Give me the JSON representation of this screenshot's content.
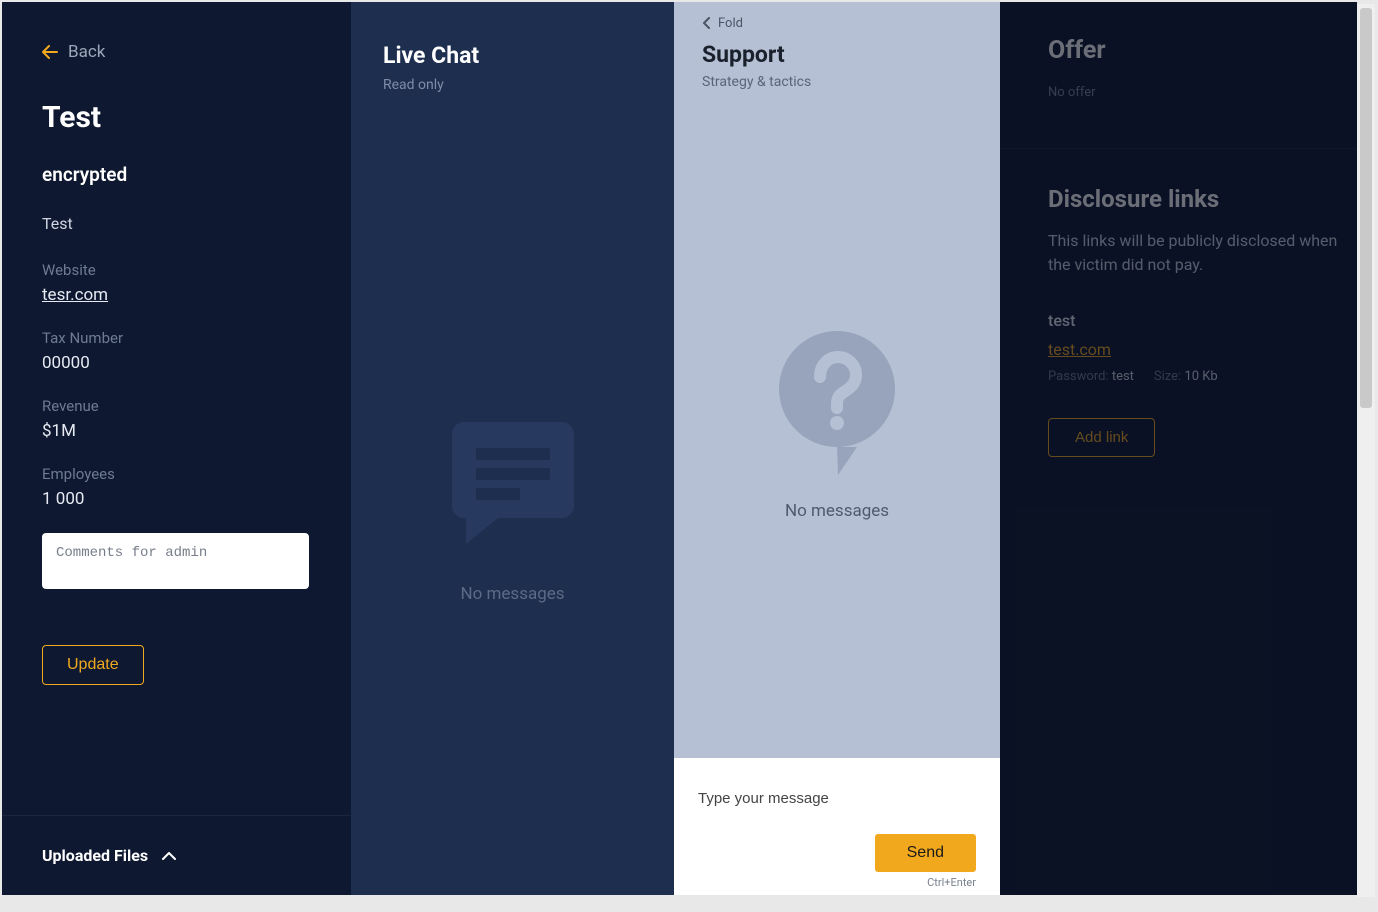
{
  "details": {
    "back_label": "Back",
    "title": "Test",
    "status": "encrypted",
    "description": "Test",
    "website_label": "Website",
    "website_value": "tesr.com",
    "tax_label": "Tax Number",
    "tax_value": "00000",
    "revenue_label": "Revenue",
    "revenue_value": "$1M",
    "employees_label": "Employees",
    "employees_value": "1 000",
    "comments_placeholder": "Comments for admin",
    "update_button": "Update",
    "uploaded_files_label": "Uploaded Files"
  },
  "live_chat": {
    "title": "Live Chat",
    "subtitle": "Read only",
    "empty_text": "No messages"
  },
  "support": {
    "fold_label": "Fold",
    "title": "Support",
    "subtitle": "Strategy & tactics",
    "empty_text": "No messages",
    "compose_placeholder": "Type your message",
    "send_button": "Send",
    "send_hint": "Ctrl+Enter"
  },
  "right": {
    "offer_title": "Offer",
    "no_offer": "No offer",
    "disclosure_title": "Disclosure links",
    "disclosure_desc": "This links will be publicly disclosed when the victim did not pay.",
    "link_name": "test",
    "link_url": "test.com",
    "password_label": "Password:",
    "password_value": "test",
    "size_label": "Size:",
    "size_value": "10 Kb",
    "add_link_button": "Add link"
  }
}
